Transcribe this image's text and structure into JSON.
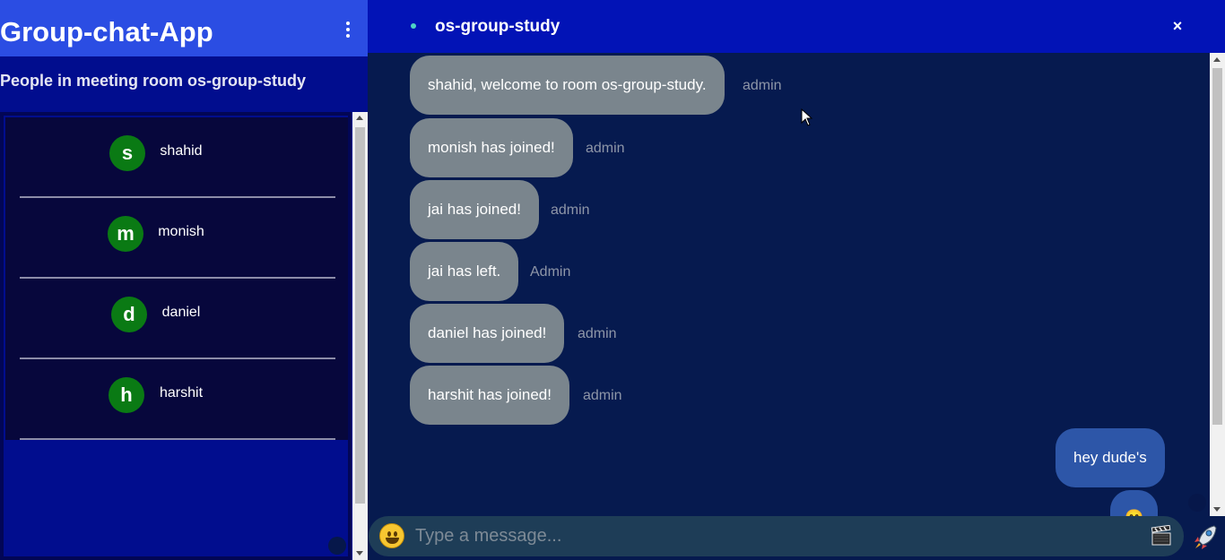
{
  "app": {
    "title": "Group-chat-App"
  },
  "sidebar": {
    "room_label": "People in meeting room os-group-study",
    "people": [
      {
        "initial": "s",
        "name": "shahid"
      },
      {
        "initial": "m",
        "name": "monish"
      },
      {
        "initial": "d",
        "name": "daniel"
      },
      {
        "initial": "h",
        "name": "harshit"
      }
    ]
  },
  "chat": {
    "room_name": "os-group-study",
    "close_label": "×",
    "messages": [
      {
        "text": "shahid, welcome to room os-group-study.",
        "sender": "admin"
      },
      {
        "text": "monish has joined!",
        "sender": "admin"
      },
      {
        "text": "jai has joined!",
        "sender": "admin"
      },
      {
        "text": "jai has left.",
        "sender": "Admin"
      },
      {
        "text": "daniel has joined!",
        "sender": "admin"
      },
      {
        "text": "harshit has joined!",
        "sender": "admin"
      }
    ],
    "own_messages": [
      {
        "text": "hey dude's"
      },
      {
        "text": "😄"
      }
    ]
  },
  "composer": {
    "placeholder": "Type a message..."
  },
  "colors": {
    "left_bg": "#010d8e",
    "left_header": "#2b4de3",
    "chat_header": "#0213b6",
    "chat_bg": "#061a4f",
    "avatar_green": "#0a7a14",
    "bubble_gray": "#7a858d",
    "own_bubble": "#2d56a8"
  },
  "icons": {
    "menu": "kebab-menu-icon",
    "close": "close-icon",
    "emoji": "emoji-icon",
    "gif": "clapperboard-icon",
    "send": "rocket-icon"
  }
}
